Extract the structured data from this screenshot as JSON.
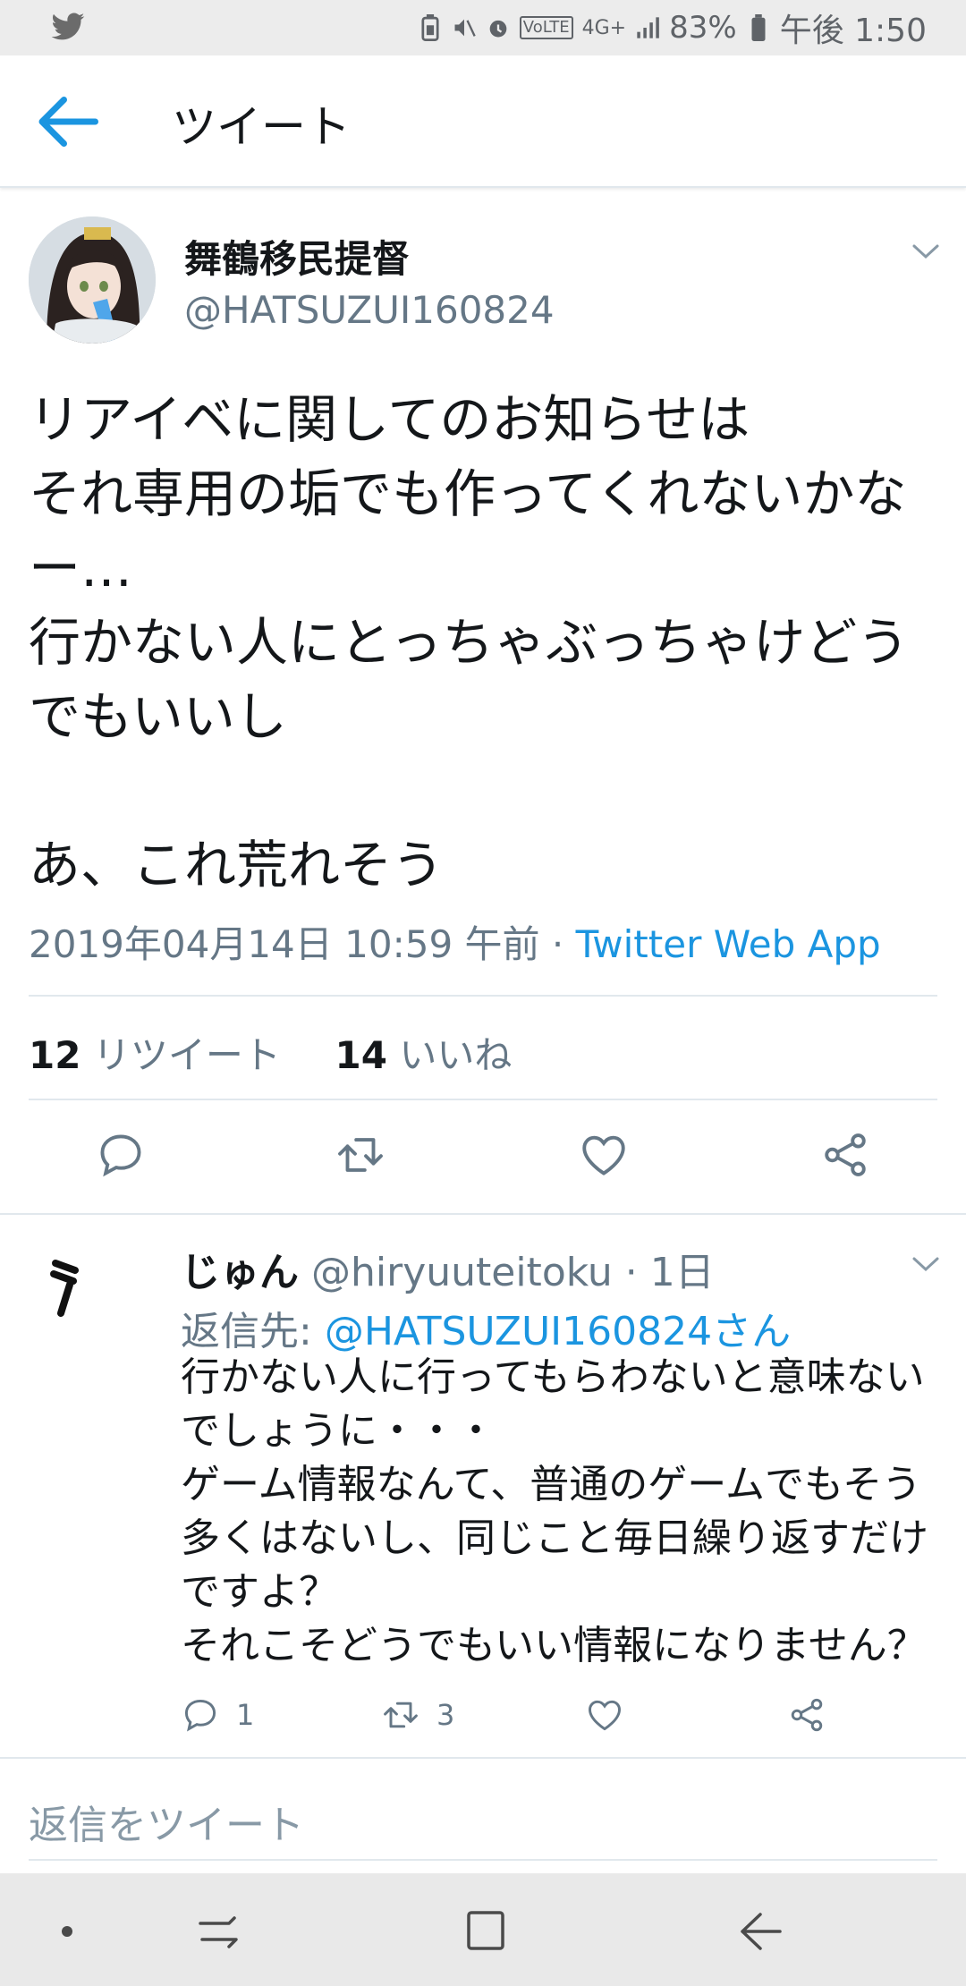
{
  "status_bar": {
    "battery": "83%",
    "time": "午後 1:50",
    "network": "4G+",
    "volte": "VoLTE",
    "icons": [
      "twitter-notification-icon",
      "battery-saver-icon",
      "mute-icon",
      "alarm-icon",
      "volte-icon",
      "network-icon",
      "signal-icon",
      "battery-icon"
    ]
  },
  "header": {
    "title": "ツイート",
    "back_icon": "arrow-left-icon"
  },
  "tweet": {
    "author_name": "舞鶴移民提督",
    "author_handle": "@HATSUZUI160824",
    "text": "リアイベに関してのお知らせは\nそれ専用の垢でも作ってくれないかなー…\n行かない人にとっちゃぶっちゃけどうでもいいし\n\nあ、これ荒れそう",
    "timestamp": "2019年04月14日 10:59 午前",
    "separator": " · ",
    "source": "Twitter Web App",
    "retweet_count": "12",
    "retweet_label": "リツイート",
    "like_count": "14",
    "like_label": "いいね",
    "actions": [
      "reply-icon",
      "retweet-icon",
      "like-icon",
      "share-icon"
    ]
  },
  "reply": {
    "name": "じゅん",
    "handle": "@hiryuuteitoku",
    "age": "1日",
    "replying_to_label": "返信先: ",
    "replying_to": "@HATSUZUI160824さん",
    "text": "行かない人に行ってもらわないと意味ないでしょうに・・・\nゲーム情報なんて、普通のゲームでもそう多くはないし、同じこと毎日繰り返すだけですよ？\nそれこそどうでもいい情報になりません？",
    "reply_count": "1",
    "retweet_count": "3"
  },
  "compose": {
    "placeholder": "返信をツイート"
  },
  "colors": {
    "accent": "#1b95e0",
    "secondary_text": "#657786",
    "divider": "#e1e8ed"
  }
}
